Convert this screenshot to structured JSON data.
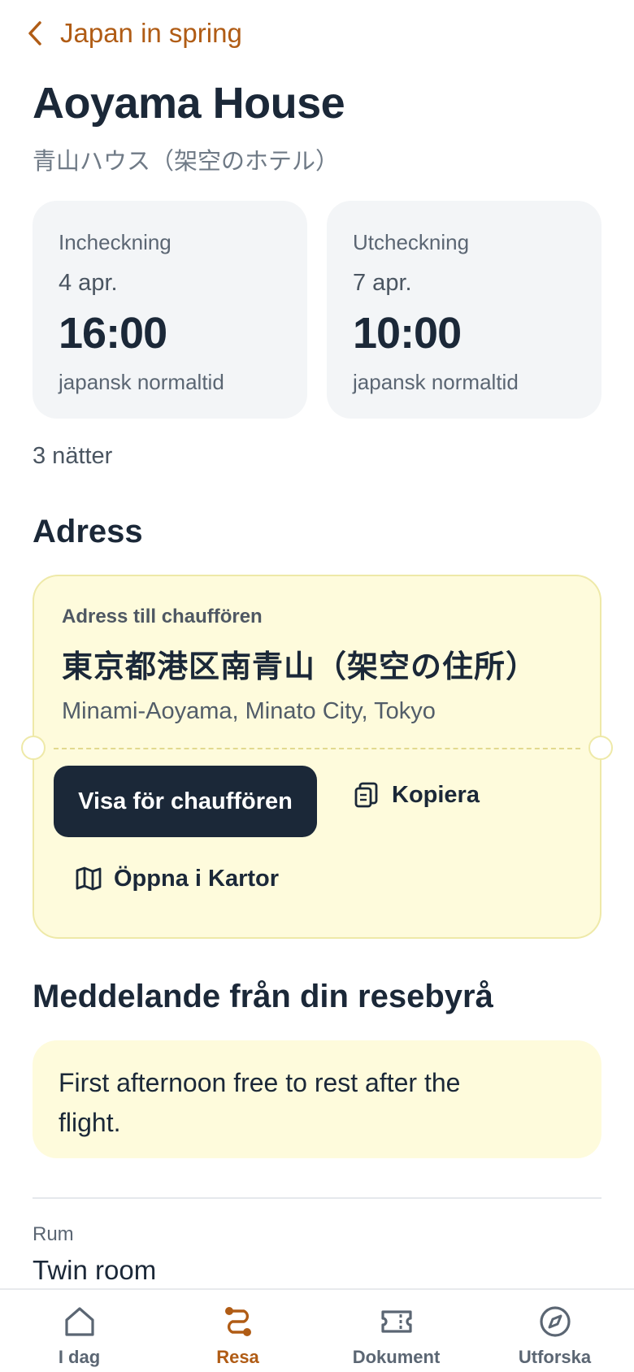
{
  "nav": {
    "back_label": "Japan in spring"
  },
  "hotel": {
    "name": "Aoyama House",
    "local_name": "青山ハウス（架空のホテル）"
  },
  "checkin": {
    "label": "Incheckning",
    "date": "4 apr.",
    "time": "16:00",
    "timezone": "japansk normaltid"
  },
  "checkout": {
    "label": "Utcheckning",
    "date": "7 apr.",
    "time": "10:00",
    "timezone": "japansk normaltid"
  },
  "nights": "3 nätter",
  "address": {
    "heading": "Adress",
    "card_label": "Adress till chauffören",
    "japanese": "東京都港区南青山（架空の住所）",
    "romaji": "Minami-Aoyama, Minato City, Tokyo",
    "show_driver_label": "Visa för chauffören",
    "copy_label": "Kopiera",
    "maps_label": "Öppna i Kartor"
  },
  "message": {
    "heading": "Meddelande från din resebyrå",
    "text": "First afternoon free to rest after the flight."
  },
  "room": {
    "label": "Rum",
    "value": "Twin room"
  },
  "tabbar": {
    "tabs": [
      {
        "label": "I dag",
        "icon": "home-icon"
      },
      {
        "label": "Resa",
        "icon": "route-icon"
      },
      {
        "label": "Dokument",
        "icon": "ticket-icon"
      },
      {
        "label": "Utforska",
        "icon": "compass-icon"
      }
    ],
    "active_index": 1
  },
  "colors": {
    "accent": "#b05c15",
    "text_primary": "#1b2838",
    "card_bg": "#f3f5f7",
    "highlight_bg": "#fefbdc",
    "button_dark": "#1b2838"
  }
}
